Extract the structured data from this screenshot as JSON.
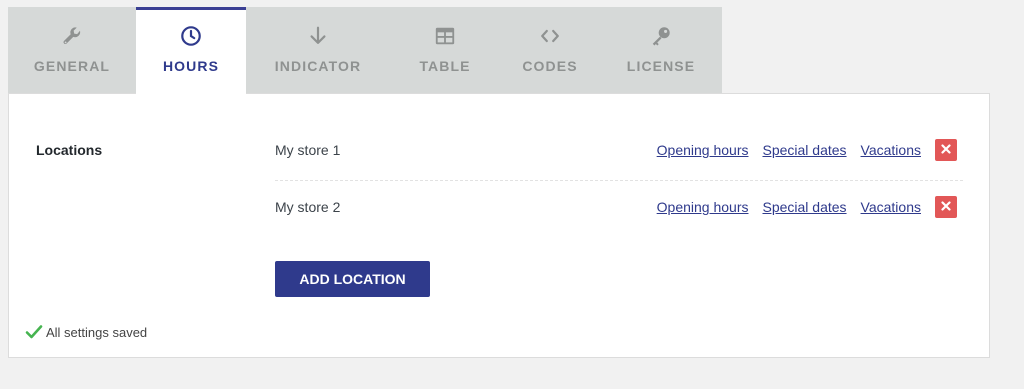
{
  "tabs": [
    {
      "label": "GENERAL",
      "icon": "wrench-icon",
      "active": false
    },
    {
      "label": "HOURS",
      "icon": "clock-icon",
      "active": true
    },
    {
      "label": "INDICATOR",
      "icon": "arrow-down-icon",
      "active": false
    },
    {
      "label": "TABLE",
      "icon": "table-icon",
      "active": false
    },
    {
      "label": "CODES",
      "icon": "code-icon",
      "active": false
    },
    {
      "label": "LICENSE",
      "icon": "key-icon",
      "active": false
    }
  ],
  "panel": {
    "section_label": "Locations",
    "locations": [
      {
        "name": "My store 1",
        "links": {
          "opening_hours": "Opening hours",
          "special_dates": "Special dates",
          "vacations": "Vacations"
        }
      },
      {
        "name": "My store 2",
        "links": {
          "opening_hours": "Opening hours",
          "special_dates": "Special dates",
          "vacations": "Vacations"
        }
      }
    ],
    "add_button_label": "ADD LOCATION",
    "status_text": "All settings saved"
  },
  "colors": {
    "accent": "#2f3a8c",
    "remove": "#e25757",
    "success": "#46b450",
    "tab_bar": "#d6d9d8",
    "tab_inactive_text": "#8f9291"
  }
}
